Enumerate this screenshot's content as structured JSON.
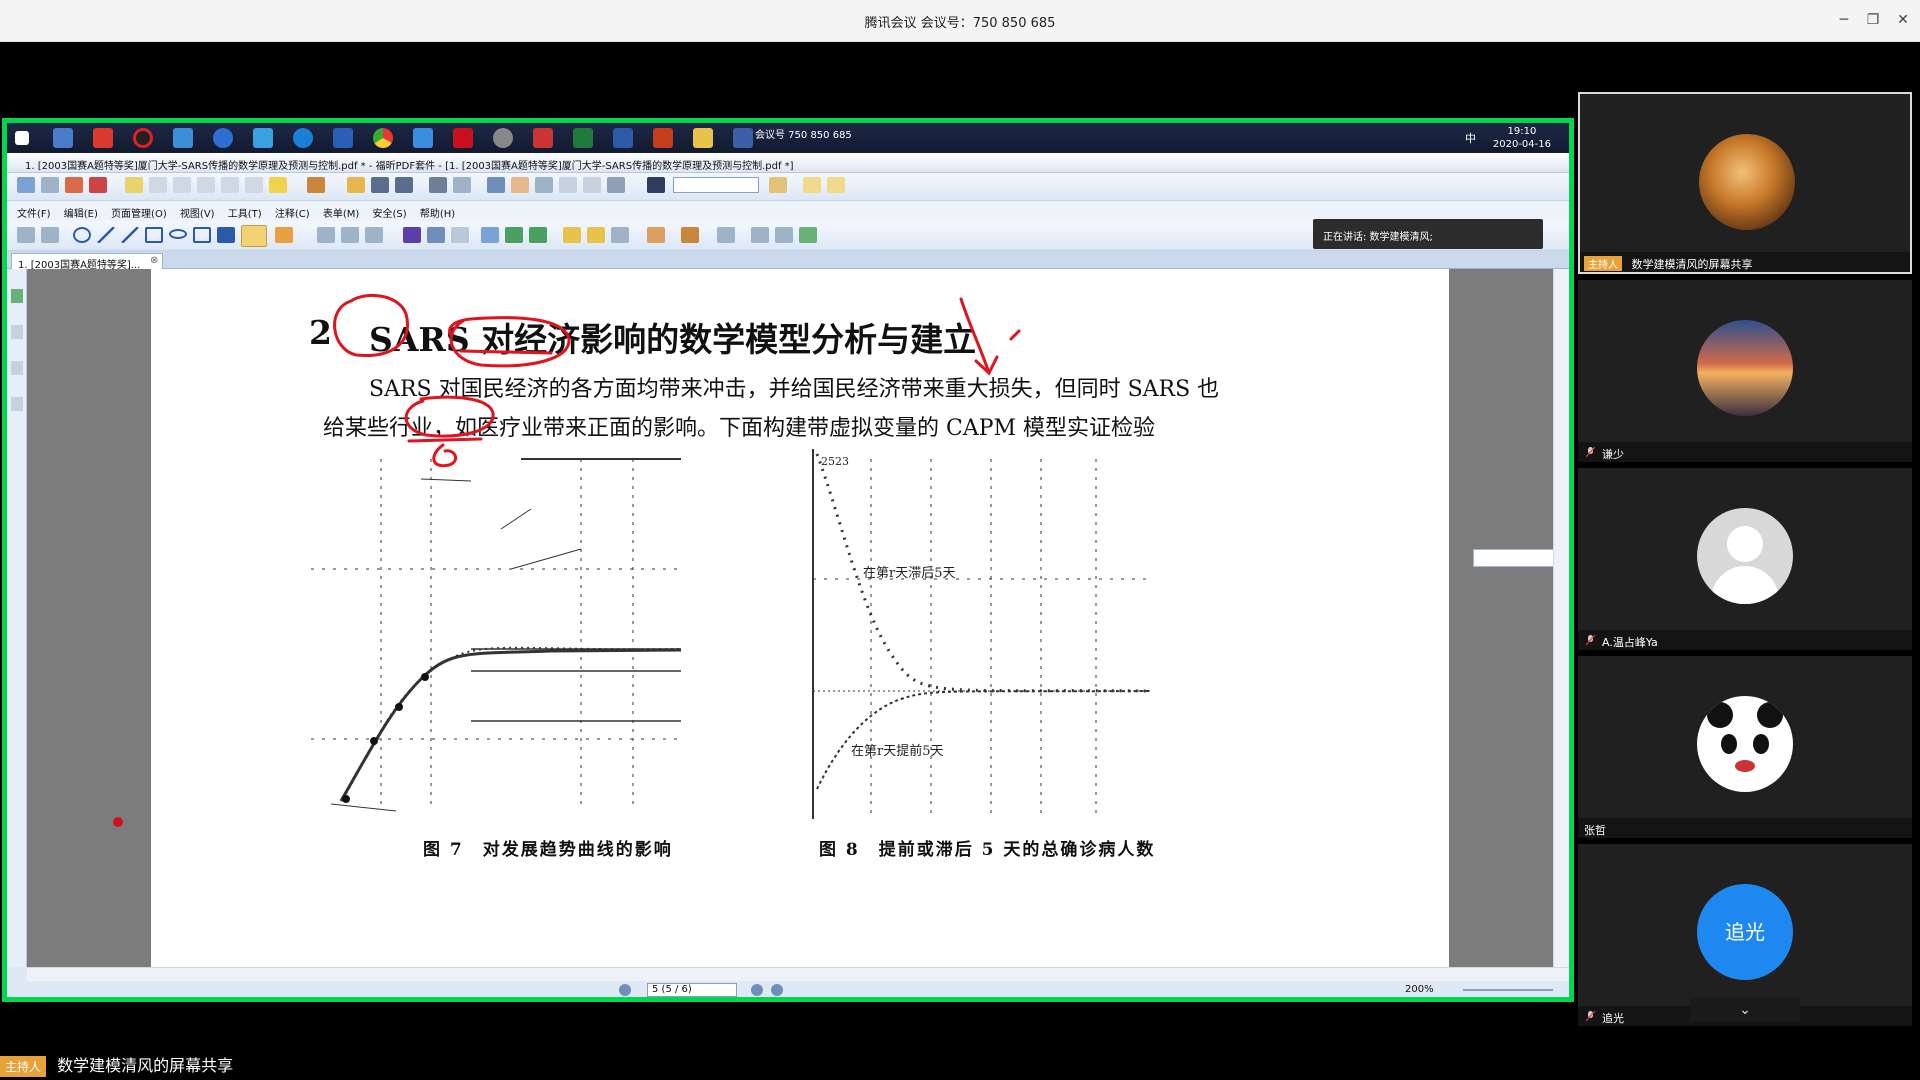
{
  "window": {
    "title": "腾讯会议 会议号：750 850 685",
    "controls": [
      "─",
      "❐",
      "✕"
    ]
  },
  "taskbar": {
    "meeting_label": "会议号 750 850 685",
    "time": "19:10",
    "date": "2020-04-16",
    "ime": "中"
  },
  "pdf_app": {
    "title": "1. [2003国赛A题特等奖]厦门大学-SARS传播的数学原理及预测与控制.pdf * - 福昕PDF套件 - [1. [2003国赛A题特等奖]厦门大学-SARS传播的数学原理及预测与控制.pdf *]",
    "menu": [
      "文件(F)",
      "编辑(E)",
      "页面管理(O)",
      "视图(V)",
      "工具(T)",
      "注释(C)",
      "表单(M)",
      "安全(S)",
      "帮助(H)"
    ],
    "speaking": "正在讲话: 数学建模清风;",
    "tab_label": "1. [2003国赛A题特等奖]...",
    "page_indicator": "5 (5 / 6)",
    "zoom": "200%"
  },
  "paper": {
    "heading_num": "2",
    "heading": "SARS 对经济影响的数学模型分析与建立",
    "line1": "SARS 对国民经济的各方面均带来冲击，并给国民经济带来重大损失，但同时 SARS 也",
    "line2": "给某些行业，如医疗业带来正面的影响。下面构建带虚拟变量的 CAPM 模型实证检验",
    "fig7_caption": "图 7　对发展趋势曲线的影响",
    "fig8_caption": "图 8　提前或滞后 5 天的总确诊病人数",
    "fig8_label_top": "在第r天滞后5天",
    "fig8_label_bottom": "在第r天提前5天",
    "fig8_y_top": "2523"
  },
  "participants": [
    {
      "name": "数学建模清风的屏幕共享",
      "host": "主持人",
      "avatar": "lion-avatar",
      "active": true
    },
    {
      "name": "谦少",
      "host": "",
      "avatar": "sunset-avatar",
      "active": false
    },
    {
      "name": "A.温占峰Ya",
      "host": "",
      "avatar": "default-avatar",
      "active": false
    },
    {
      "name": "张哲",
      "host": "",
      "avatar": "panda-avatar",
      "active": false
    },
    {
      "name": "追光",
      "host": "",
      "avatar": "text-avatar",
      "avatar_text": "追光",
      "active": false
    }
  ],
  "share_label": {
    "host": "主持人",
    "text": "数学建模清风的屏幕共享"
  },
  "colors": {
    "share_border": "#00d64f",
    "host_tag": "#e8a23a",
    "annotation": "#e0141e",
    "avatar_blue": "#1e88f0"
  }
}
